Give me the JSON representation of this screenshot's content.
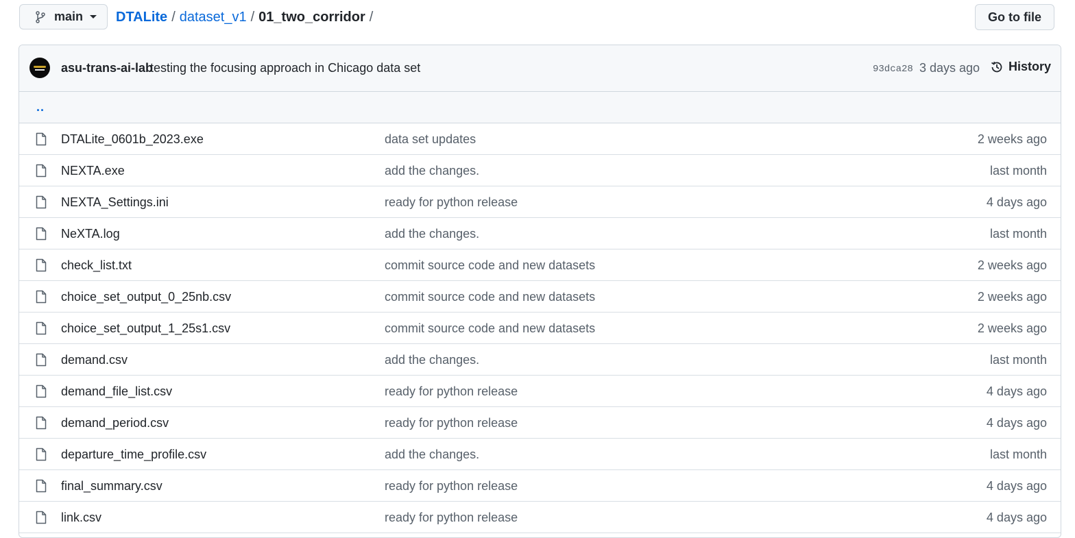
{
  "topbar": {
    "branch": "main",
    "breadcrumb": {
      "root": "DTALite",
      "sep1": "/",
      "folder": "dataset_v1",
      "sep2": "/",
      "current": "01_two_corridor",
      "sep3": "/"
    },
    "goto_label": "Go to file"
  },
  "commit": {
    "author": "asu-trans-ai-lab",
    "message": "testing the focusing approach in Chicago data set",
    "sha": "93dca28",
    "time": "3 days ago",
    "history_label": "History"
  },
  "parent_link": "..",
  "files": [
    {
      "name": "DTALite_0601b_2023.exe",
      "commit": "data set updates",
      "time": "2 weeks ago"
    },
    {
      "name": "NEXTA.exe",
      "commit": "add the changes.",
      "time": "last month"
    },
    {
      "name": "NEXTA_Settings.ini",
      "commit": "ready for python release",
      "time": "4 days ago"
    },
    {
      "name": "NeXTA.log",
      "commit": "add the changes.",
      "time": "last month"
    },
    {
      "name": "check_list.txt",
      "commit": "commit source code and new datasets",
      "time": "2 weeks ago"
    },
    {
      "name": "choice_set_output_0_25nb.csv",
      "commit": "commit source code and new datasets",
      "time": "2 weeks ago"
    },
    {
      "name": "choice_set_output_1_25s1.csv",
      "commit": "commit source code and new datasets",
      "time": "2 weeks ago"
    },
    {
      "name": "demand.csv",
      "commit": "add the changes.",
      "time": "last month"
    },
    {
      "name": "demand_file_list.csv",
      "commit": "ready for python release",
      "time": "4 days ago"
    },
    {
      "name": "demand_period.csv",
      "commit": "ready for python release",
      "time": "4 days ago"
    },
    {
      "name": "departure_time_profile.csv",
      "commit": "add the changes.",
      "time": "last month"
    },
    {
      "name": "final_summary.csv",
      "commit": "ready for python release",
      "time": "4 days ago"
    },
    {
      "name": "link.csv",
      "commit": "ready for python release",
      "time": "4 days ago"
    }
  ],
  "colors": {
    "link": "#0969da",
    "muted": "#57606a",
    "border": "#d0d7de",
    "header_bg": "#f6f8fa"
  },
  "icons": {
    "branch": "git-branch-icon",
    "history": "history-clock-icon",
    "file": "file-icon"
  }
}
